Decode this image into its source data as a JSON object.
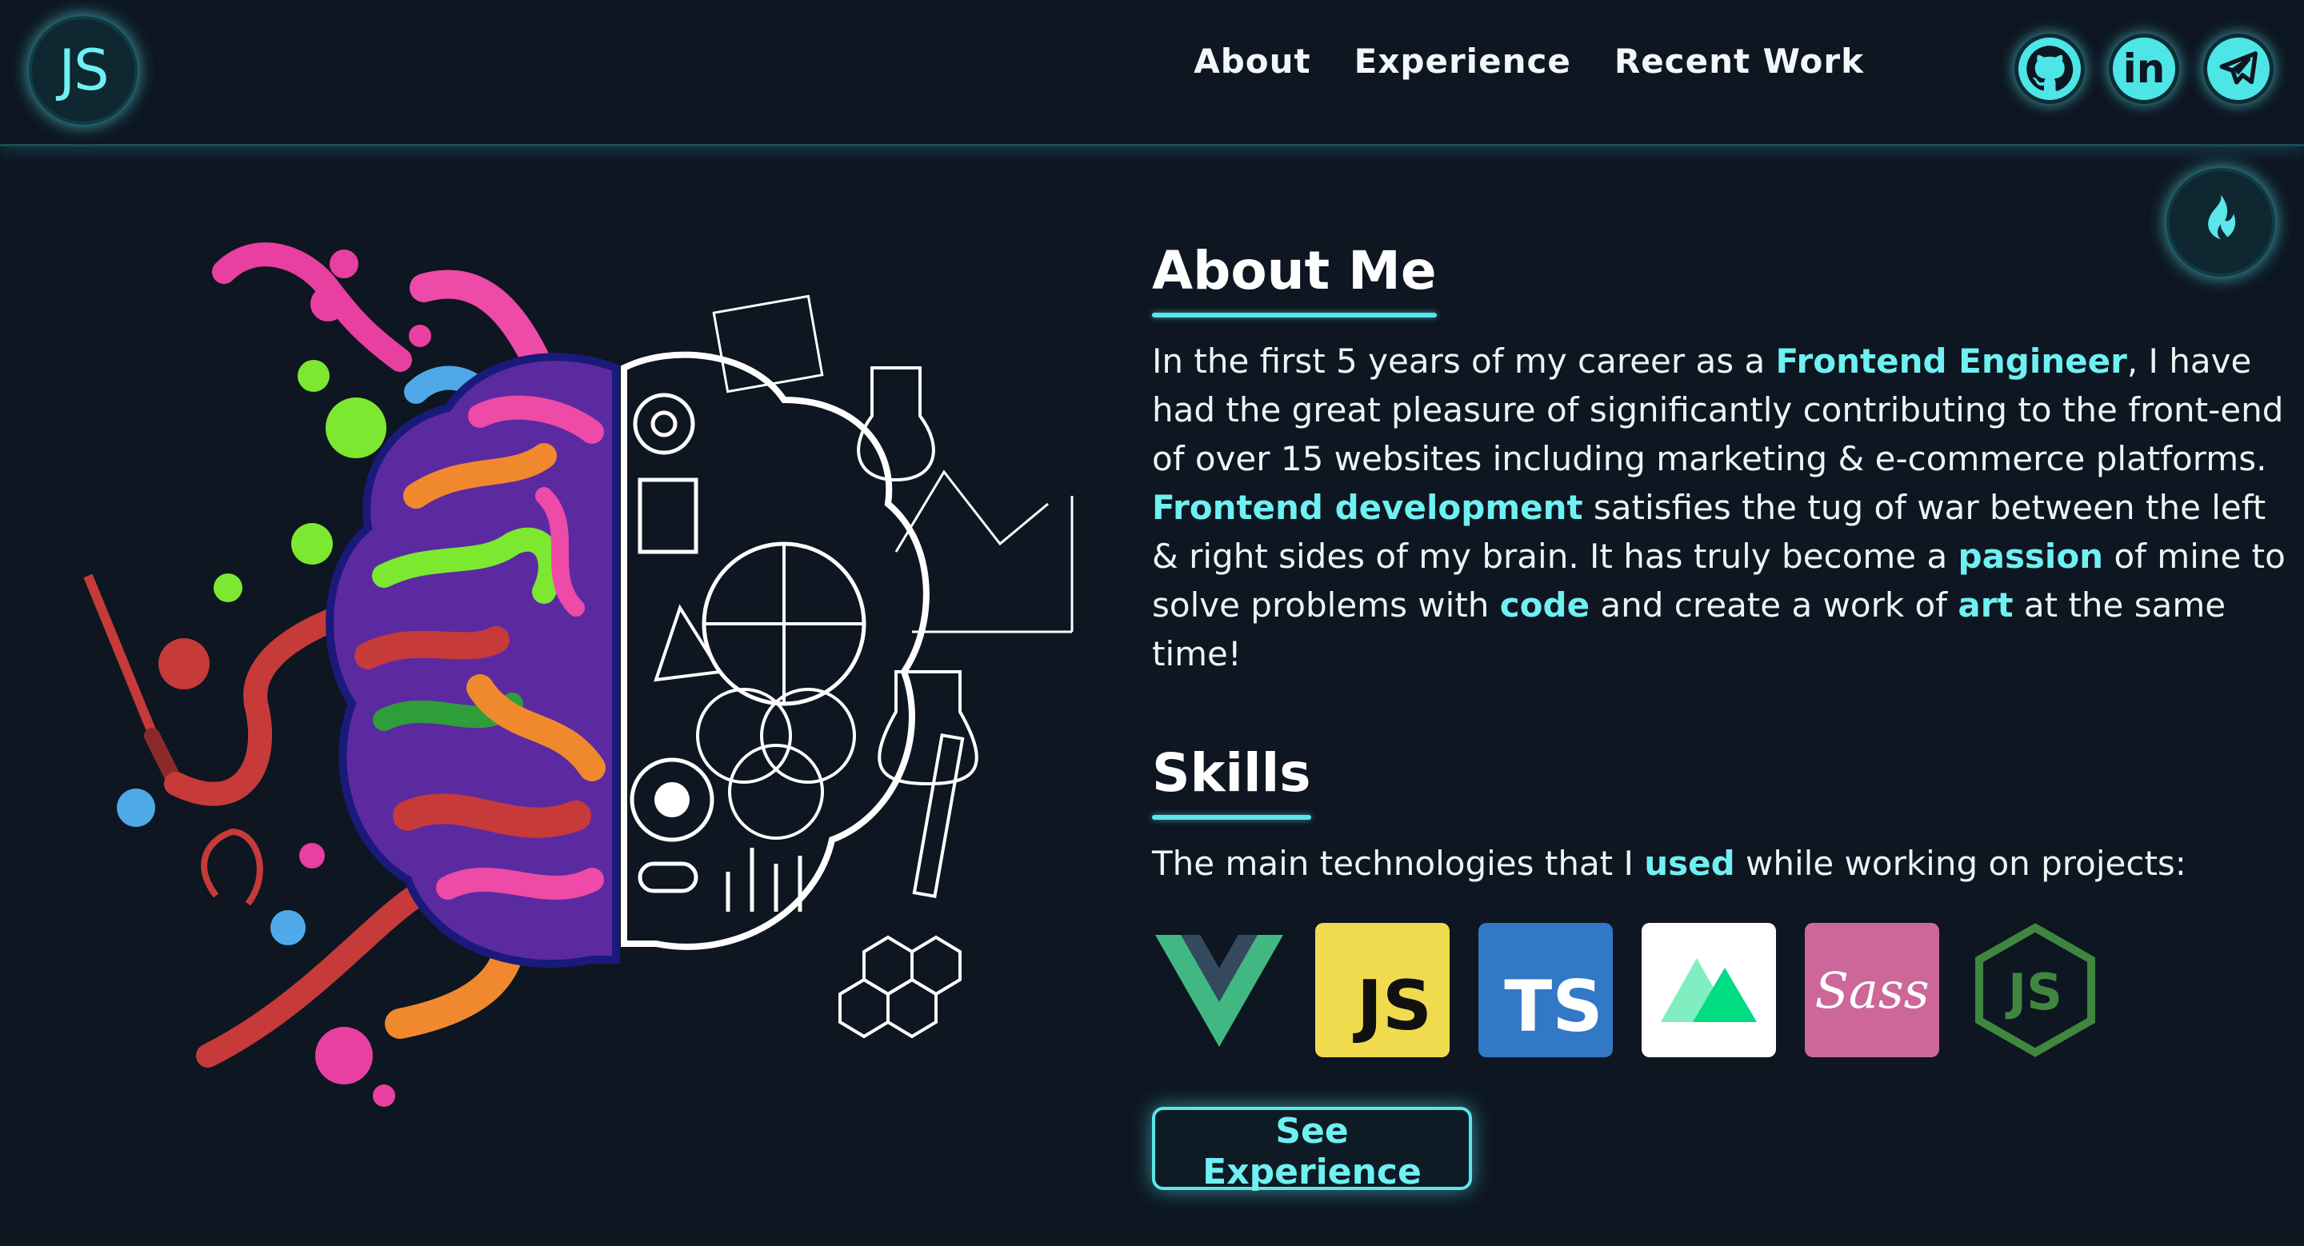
{
  "header": {
    "logo_text": "JS",
    "nav": [
      {
        "label": "About"
      },
      {
        "label": "Experience"
      },
      {
        "label": "Recent Work"
      }
    ],
    "socials": [
      {
        "icon": "github-icon"
      },
      {
        "icon": "linkedin-icon",
        "text": "in"
      },
      {
        "icon": "telegram-icon"
      }
    ],
    "theme_toggle_icon": "flame-icon"
  },
  "about": {
    "title": "About Me",
    "p1": "In the first 5 years of my career as a ",
    "h1": "Frontend Engineer",
    "p2": ", I have had the great pleasure of significantly contributing to the front-end of over 15 websites including marketing & e-commerce platforms. ",
    "h2": "Frontend development",
    "p3": " satisfies the tug of war between the left & right sides of my brain. It has truly become a ",
    "h3": "passion",
    "p4": " of mine to solve problems with ",
    "h4": "code",
    "p5": " and create a work of ",
    "h5": "art",
    "p6": " at the same time!"
  },
  "skills": {
    "title": "Skills",
    "p1": "The main technologies that I ",
    "h1": "used",
    "p2": " while working on projects:",
    "items": [
      {
        "name": "Vue",
        "icon": "vue-icon"
      },
      {
        "name": "JavaScript",
        "icon": "javascript-icon",
        "text": "JS"
      },
      {
        "name": "TypeScript",
        "icon": "typescript-icon",
        "text": "TS"
      },
      {
        "name": "Nuxt",
        "icon": "nuxt-icon"
      },
      {
        "name": "Sass",
        "icon": "sass-icon",
        "text": "Sass"
      },
      {
        "name": "Node.js",
        "icon": "nodejs-icon",
        "text": "JS"
      }
    ]
  },
  "cta": {
    "label": "See Experience"
  },
  "colors": {
    "background": "#0d1621",
    "accent": "#5be6ea",
    "text": "#eef3f5"
  }
}
